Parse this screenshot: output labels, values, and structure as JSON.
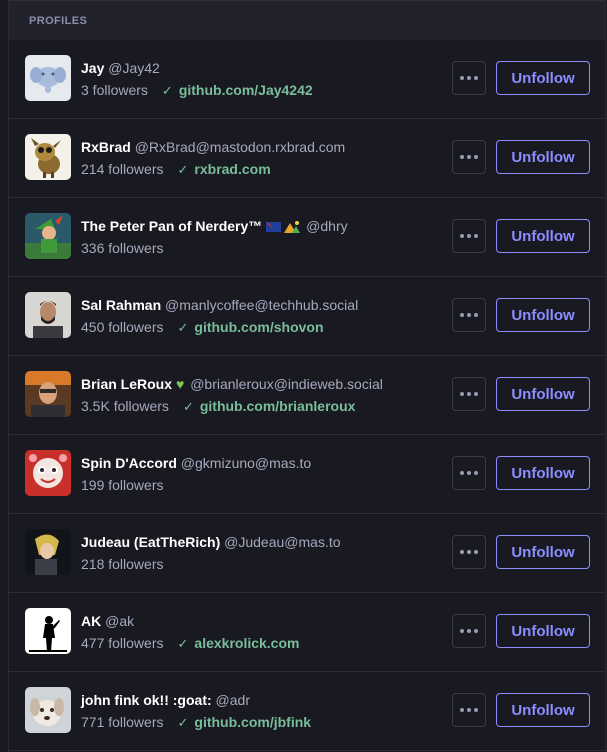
{
  "section": {
    "title": "PROFILES"
  },
  "profiles": [
    {
      "name": "Jay",
      "handle": "@Jay42",
      "followers": "3 followers",
      "verified_link": "github.com/Jay4242",
      "avatar": "elephant-avatar",
      "button": "Unfollow"
    },
    {
      "name": "RxBrad",
      "handle": "@RxBrad@mastodon.rxbrad.com",
      "followers": "214 followers",
      "verified_link": "rxbrad.com",
      "avatar": "creature-avatar",
      "button": "Unfollow"
    },
    {
      "name": "The Peter Pan of Nerdery™",
      "handle": "@dhry",
      "followers": "336 followers",
      "verified_link": "",
      "avatar": "peter-pan-avatar",
      "button": "Unfollow"
    },
    {
      "name": "Sal Rahman",
      "handle": "@manlycoffee@techhub.social",
      "followers": "450 followers",
      "verified_link": "github.com/shovon",
      "avatar": "person-avatar",
      "button": "Unfollow"
    },
    {
      "name": "Brian LeRoux",
      "handle": "@brianleroux@indieweb.social",
      "followers": "3.5K followers",
      "verified_link": "github.com/brianleroux",
      "avatar": "person-avatar",
      "button": "Unfollow"
    },
    {
      "name": "Spin D'Accord",
      "handle": "@gkmizuno@mas.to",
      "followers": "199 followers",
      "verified_link": "",
      "avatar": "cartoon-avatar",
      "button": "Unfollow"
    },
    {
      "name": "Judeau (EatTheRich)",
      "handle": "@Judeau@mas.to",
      "followers": "218 followers",
      "verified_link": "",
      "avatar": "anime-avatar",
      "button": "Unfollow"
    },
    {
      "name": "AK",
      "handle": "@ak",
      "followers": "477 followers",
      "verified_link": "alexkrolick.com",
      "avatar": "silhouette-avatar",
      "button": "Unfollow"
    },
    {
      "name": "john fink ok!! :goat:",
      "handle": "@adr",
      "followers": "771 followers",
      "verified_link": "github.com/jbfink",
      "avatar": "dog-avatar",
      "button": "Unfollow"
    }
  ],
  "colors": {
    "accent": "#8c8dff",
    "verified": "#79bd9a",
    "background": "#191922",
    "muted": "#a8a8bd"
  },
  "icons": {
    "more": "ellipsis-icon",
    "verified": "check-icon"
  }
}
